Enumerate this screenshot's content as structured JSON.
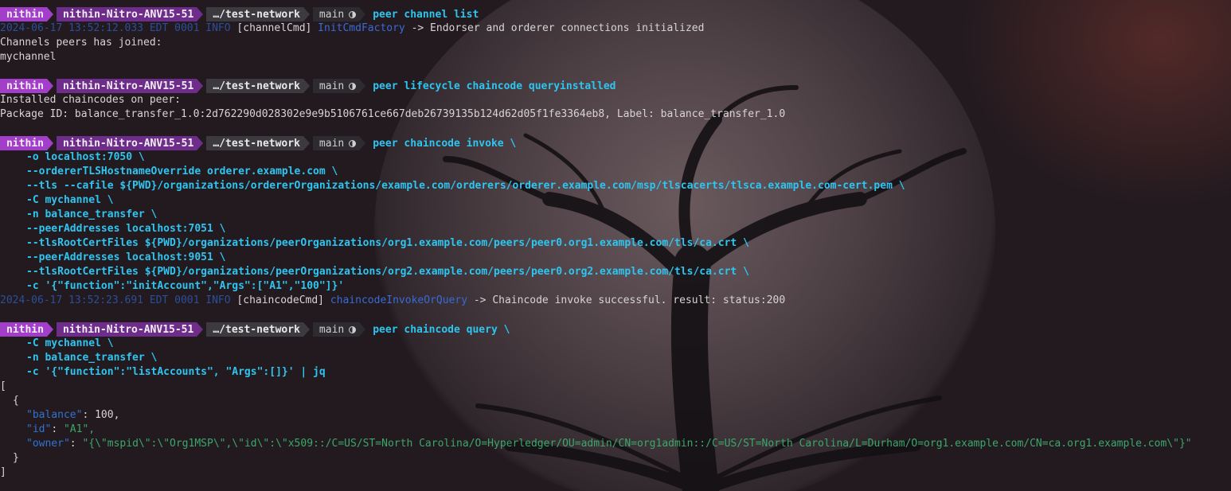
{
  "prompt": {
    "user": "nithin",
    "host": "nithin-Nitro-ANV15-51",
    "dir": "…/test-network",
    "branch": "main",
    "branch_icon": "git-status-icon"
  },
  "blocks": [
    {
      "command": "peer channel list",
      "cont": [],
      "output": [
        {
          "kind": "log",
          "ts": "2024-06-17 13:52:12.033 EDT 0001 INFO",
          "tag": "[channelCmd]",
          "func": "InitCmdFactory",
          "msg": "-> Endorser and orderer connections initialized"
        },
        {
          "kind": "text",
          "text": "Channels peers has joined:"
        },
        {
          "kind": "text",
          "text": "mychannel"
        }
      ]
    },
    {
      "command": "peer lifecycle chaincode queryinstalled",
      "cont": [],
      "output": [
        {
          "kind": "text",
          "text": "Installed chaincodes on peer:"
        },
        {
          "kind": "text",
          "text": "Package ID: balance_transfer_1.0:2d762290d028302e9e9b5106761ce667deb26739135b124d62d05f1fe3364eb8, Label: balance_transfer_1.0"
        }
      ]
    },
    {
      "command": "peer chaincode invoke \\",
      "cont": [
        "-o localhost:7050 \\",
        "--ordererTLSHostnameOverride orderer.example.com \\",
        "--tls --cafile ${PWD}/organizations/ordererOrganizations/example.com/orderers/orderer.example.com/msp/tlscacerts/tlsca.example.com-cert.pem \\",
        "-C mychannel \\",
        "-n balance_transfer \\",
        "--peerAddresses localhost:7051 \\",
        "--tlsRootCertFiles ${PWD}/organizations/peerOrganizations/org1.example.com/peers/peer0.org1.example.com/tls/ca.crt \\",
        "--peerAddresses localhost:9051 \\",
        "--tlsRootCertFiles ${PWD}/organizations/peerOrganizations/org2.example.com/peers/peer0.org2.example.com/tls/ca.crt \\",
        "-c '{\"function\":\"initAccount\",\"Args\":[\"A1\",\"100\"]}'"
      ],
      "output": [
        {
          "kind": "log",
          "ts": "2024-06-17 13:52:23.691 EDT 0001 INFO",
          "tag": "[chaincodeCmd]",
          "func": "chaincodeInvokeOrQuery",
          "msg": "-> Chaincode invoke successful. result: status:200"
        }
      ]
    },
    {
      "command": "peer chaincode query \\",
      "cont": [
        "-C mychannel \\",
        "-n balance_transfer \\",
        "-c '{\"function\":\"listAccounts\", \"Args\":[]}' | jq"
      ],
      "output": []
    }
  ],
  "json_output": {
    "open_bracket": "[",
    "open_brace": "{",
    "fields": [
      {
        "key": "\"balance\"",
        "value": "100,",
        "vtype": "num"
      },
      {
        "key": "\"id\"",
        "value": "\"A1\",",
        "vtype": "str"
      },
      {
        "key": "\"owner\"",
        "value": "\"{\\\"mspid\\\":\\\"Org1MSP\\\",\\\"id\\\":\\\"x509::/C=US/ST=North Carolina/O=Hyperledger/OU=admin/CN=org1admin::/C=US/ST=North Carolina/L=Durham/O=org1.example.com/CN=ca.org1.example.com\\\"}\"",
        "vtype": "str"
      }
    ],
    "close_brace": "}",
    "close_bracket": "]"
  },
  "colors": {
    "background": "#231a1f",
    "user_segment": "#a23ec9",
    "host_segment": "#6f2d8b",
    "command": "#2ec5f0",
    "timestamp": "#2a4f9a",
    "json_key": "#2f74d0",
    "json_string": "#3aa86a"
  }
}
